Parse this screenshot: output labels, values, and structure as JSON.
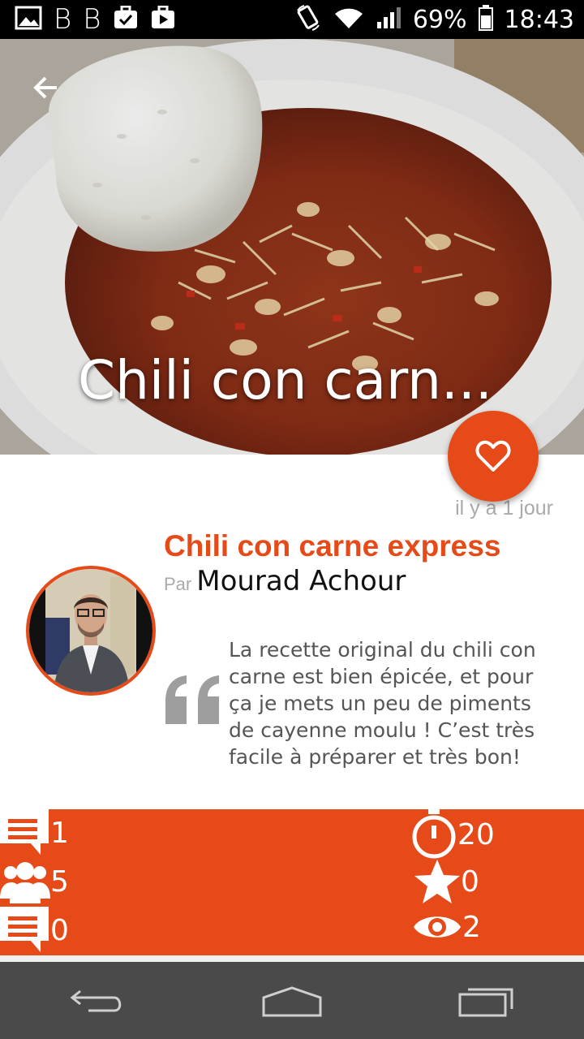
{
  "status_bar": {
    "icons_left": [
      "image-icon",
      "b-icon",
      "b-icon",
      "briefcase-check-icon",
      "play-store-icon"
    ],
    "b_glyph": "B",
    "battery": "69%",
    "time": "18:43"
  },
  "hero": {
    "title": "Chili con carn..."
  },
  "recipe": {
    "time_ago": "il y a 1 jour",
    "title": "Chili con carne express",
    "by_label": "Par",
    "author": "Mourad Achour",
    "description": "La recette original du chili con carne est bien épicée, et pour ça je mets un peu de piments de cayenne moulu ! C’est très facile à préparer et très bon!"
  },
  "stats": {
    "comments": "1",
    "people": "5",
    "notes": "0",
    "time": "20",
    "rating": "0",
    "views": "2"
  },
  "colors": {
    "accent": "#e64a19",
    "muted": "#aaaaaa",
    "navbar": "#4a4a4a"
  }
}
